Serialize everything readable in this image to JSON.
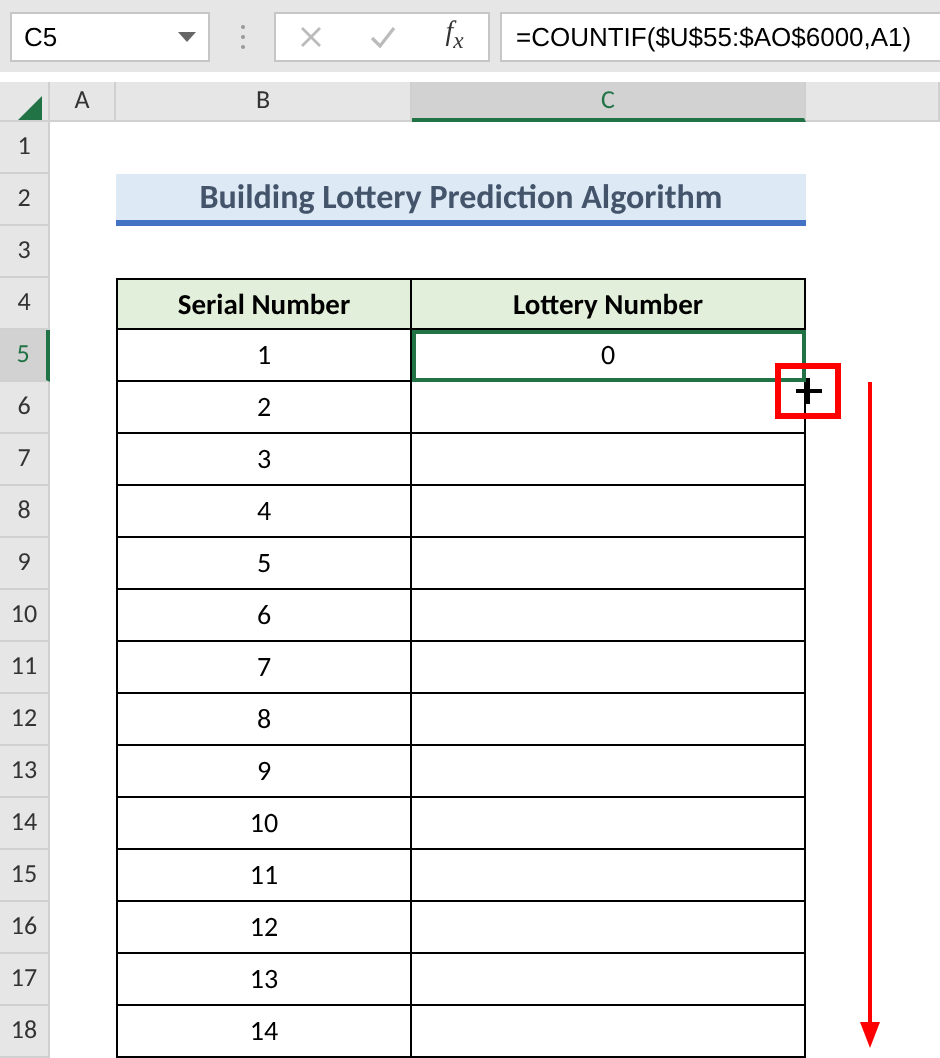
{
  "formula_bar": {
    "name_box": "C5",
    "fx": "f$_{x}$",
    "formula": "=COUNTIF($U$55:$AO$6000,A1)"
  },
  "columns": [
    {
      "label": "A",
      "selected": false
    },
    {
      "label": "B",
      "selected": false
    },
    {
      "label": "C",
      "selected": true
    }
  ],
  "rows": [
    {
      "label": "1",
      "selected": false
    },
    {
      "label": "2",
      "selected": false
    },
    {
      "label": "3",
      "selected": false
    },
    {
      "label": "4",
      "selected": false
    },
    {
      "label": "5",
      "selected": true
    },
    {
      "label": "6",
      "selected": false
    },
    {
      "label": "7",
      "selected": false
    },
    {
      "label": "8",
      "selected": false
    },
    {
      "label": "9",
      "selected": false
    },
    {
      "label": "10",
      "selected": false
    },
    {
      "label": "11",
      "selected": false
    },
    {
      "label": "12",
      "selected": false
    },
    {
      "label": "13",
      "selected": false
    },
    {
      "label": "14",
      "selected": false
    },
    {
      "label": "15",
      "selected": false
    },
    {
      "label": "16",
      "selected": false
    },
    {
      "label": "17",
      "selected": false
    },
    {
      "label": "18",
      "selected": false
    }
  ],
  "title": "Building Lottery Prediction Algorithm",
  "table": {
    "columns": [
      "Serial Number",
      "Lottery Number"
    ],
    "rows": [
      {
        "serial": "1",
        "lottery": "0",
        "selected": true
      },
      {
        "serial": "2",
        "selected": false
      },
      {
        "serial": "3",
        "selected": false
      },
      {
        "serial": "4",
        "selected": false
      },
      {
        "serial": "5",
        "selected": false
      },
      {
        "serial": "6",
        "selected": false
      },
      {
        "serial": "7",
        "selected": false
      },
      {
        "serial": "8",
        "selected": false
      },
      {
        "serial": "9",
        "selected": false
      },
      {
        "serial": "10",
        "selected": false
      },
      {
        "serial": "11",
        "selected": false
      },
      {
        "serial": "12",
        "selected": false
      },
      {
        "serial": "13",
        "selected": false
      },
      {
        "serial": "14",
        "selected": false
      }
    ]
  }
}
